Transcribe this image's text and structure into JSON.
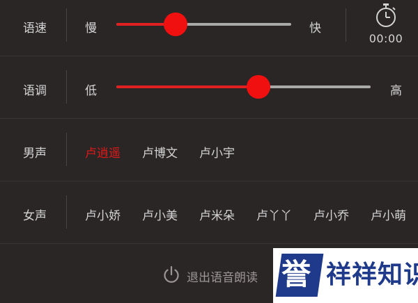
{
  "speed": {
    "label": "语速",
    "min_label": "慢",
    "max_label": "快",
    "value_fraction": 0.34
  },
  "pitch": {
    "label": "语调",
    "min_label": "低",
    "max_label": "高",
    "value_fraction": 0.56
  },
  "timer": {
    "icon": "stopwatch-icon",
    "time": "00:00"
  },
  "male_voices": {
    "label": "男声",
    "items": [
      "卢逍遥",
      "卢博文",
      "卢小宇"
    ],
    "selected_index": 0
  },
  "female_voices": {
    "label": "女声",
    "items": [
      "卢小娇",
      "卢小美",
      "卢米朵",
      "卢丫丫",
      "卢小乔",
      "卢小萌"
    ]
  },
  "exit": {
    "icon": "power-icon",
    "label": "退出语音朗读"
  },
  "watermark": {
    "logo_char": "誉",
    "text": "祥祥知识"
  },
  "colors": {
    "accent": "#e02020",
    "background": "#2a2626"
  }
}
